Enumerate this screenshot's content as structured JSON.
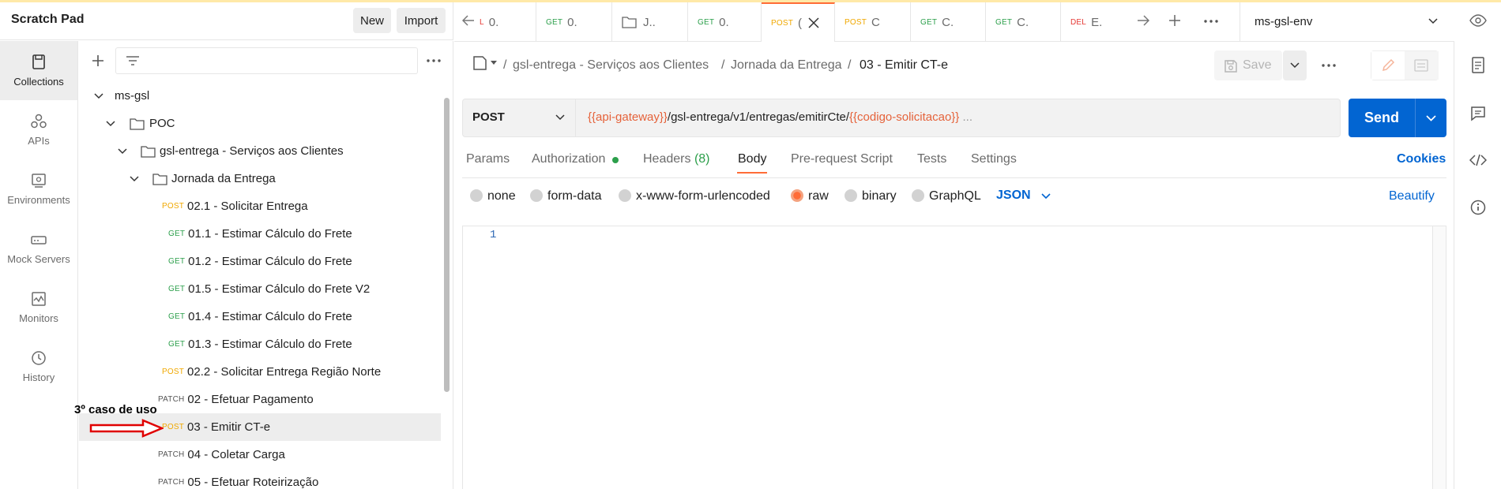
{
  "workspace": {
    "title": "Scratch Pad",
    "new_label": "New",
    "import_label": "Import"
  },
  "rail": [
    {
      "label": "Collections",
      "icon": "collections-icon"
    },
    {
      "label": "APIs",
      "icon": "apis-icon"
    },
    {
      "label": "Environments",
      "icon": "environments-icon"
    },
    {
      "label": "Mock Servers",
      "icon": "mock-servers-icon"
    },
    {
      "label": "Monitors",
      "icon": "monitors-icon"
    },
    {
      "label": "History",
      "icon": "history-icon"
    }
  ],
  "tree": {
    "root": "ms-gsl",
    "poc": "POC",
    "folder1": "gsl-entrega - Serviços aos Clientes",
    "folder2": "Jornada da Entrega",
    "requests": [
      {
        "method": "POST",
        "name": "02.1 - Solicitar Entrega"
      },
      {
        "method": "GET",
        "name": "01.1 - Estimar Cálculo do Frete"
      },
      {
        "method": "GET",
        "name": "01.2 - Estimar Cálculo do Frete"
      },
      {
        "method": "GET",
        "name": "01.5 - Estimar Cálculo do Frete V2"
      },
      {
        "method": "GET",
        "name": "01.4 - Estimar Cálculo do Frete"
      },
      {
        "method": "GET",
        "name": "01.3 - Estimar Cálculo do Frete"
      },
      {
        "method": "POST",
        "name": "02.2 - Solicitar Entrega Região Norte"
      },
      {
        "method": "PATCH",
        "name": "02 - Efetuar Pagamento"
      },
      {
        "method": "POST",
        "name": "03 - Emitir CT-e"
      },
      {
        "method": "PATCH",
        "name": "04 - Coletar Carga"
      },
      {
        "method": "PATCH",
        "name": "05 - Efetuar Roteirização"
      }
    ]
  },
  "annotation": "3º caso de uso",
  "tabs": [
    {
      "method": "L",
      "label": "0."
    },
    {
      "method": "GET",
      "label": "0."
    },
    {
      "method": "",
      "label": "J.."
    },
    {
      "method": "GET",
      "label": "0."
    },
    {
      "method": "POST",
      "label": "("
    },
    {
      "method": "POST",
      "label": "C"
    },
    {
      "method": "GET",
      "label": "C."
    },
    {
      "method": "GET",
      "label": "C."
    },
    {
      "method": "DEL",
      "label": "E."
    }
  ],
  "environment": "ms-gsl-env",
  "breadcrumb": {
    "sep": "/",
    "c1": "gsl-entrega - Serviços aos Clientes",
    "c2": "Jornada da Entrega",
    "current": "03 - Emitir CT-e"
  },
  "request": {
    "method": "POST",
    "url_var1": "{{api-gateway}}",
    "url_mid": "/gsl-entrega/v1/entregas/emitirCte/",
    "url_var2": "{{codigo-solicitacao}}",
    "url_tail": " ...",
    "save_label": "Save",
    "send_label": "Send"
  },
  "subtabs": {
    "params": "Params",
    "authorization": "Authorization",
    "headers": "Headers",
    "headers_count": "(8)",
    "body": "Body",
    "prerequest": "Pre-request Script",
    "tests": "Tests",
    "settings": "Settings",
    "cookies": "Cookies"
  },
  "body_types": {
    "none": "none",
    "formdata": "form-data",
    "urlencoded": "x-www-form-urlencoded",
    "raw": "raw",
    "binary": "binary",
    "graphql": "GraphQL",
    "format": "JSON",
    "beautify": "Beautify"
  },
  "editor": {
    "line1": "1"
  },
  "colors": {
    "accent": "#ff6c37",
    "send": "#0265d2",
    "post": "#f0a800",
    "get": "#2c9f4b",
    "del": "#e53935"
  }
}
